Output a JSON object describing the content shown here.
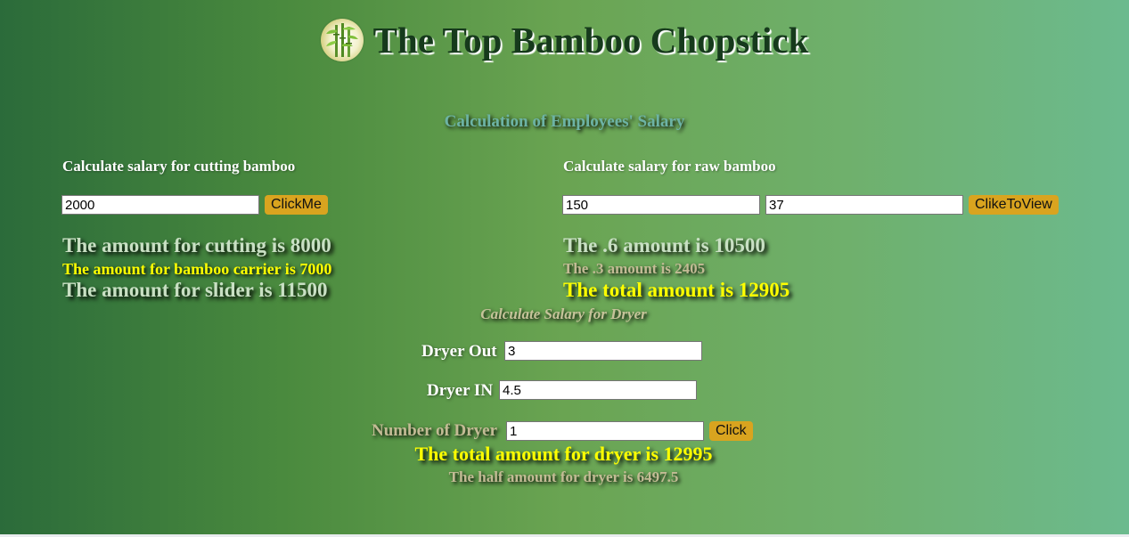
{
  "header": {
    "title": "The Top Bamboo Chopstick",
    "logo_icon": "bamboo-logo-icon"
  },
  "subtitle": "Calculation of Employees' Salary",
  "cutting": {
    "label": "Calculate salary for cutting bamboo",
    "input_value": "2000",
    "button": "ClickMe",
    "result_cutting": "The amount for cutting is 8000",
    "result_carrier": "The amount for bamboo carrier is 7000",
    "result_slider": "The amount for slider is 11500"
  },
  "raw": {
    "label": "Calculate salary for raw bamboo",
    "input1_value": "150",
    "input2_value": "37",
    "button": "ClikeToView",
    "result_06": "The .6 amount is 10500",
    "result_03": "The .3 amount is 2405",
    "result_total": "The total amount is 12905"
  },
  "dryer": {
    "title": "Calculate Salary for Dryer",
    "out_label": "Dryer Out",
    "out_value": "3",
    "in_label": "Dryer IN",
    "in_value": "4.5",
    "count_label": "Number of Dryer",
    "count_value": "1",
    "button": "Click",
    "result_total": "The total amount for dryer is 12995",
    "result_half": "The half amount for dryer is 6497.5"
  },
  "colors": {
    "button": "#d9a41f",
    "yellow_text": "#ffff00",
    "title_text": "#163a1c"
  }
}
